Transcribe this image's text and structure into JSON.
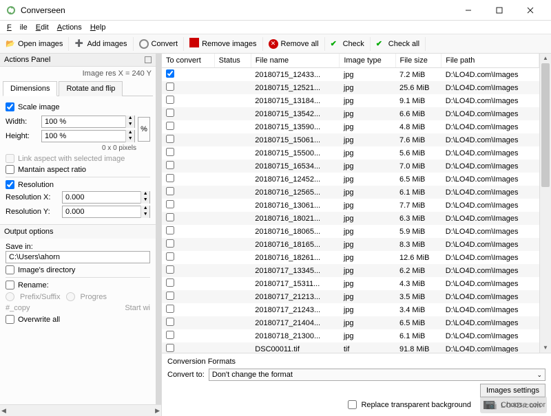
{
  "window": {
    "title": "Converseen"
  },
  "menu": {
    "file": "File",
    "edit": "Edit",
    "actions": "Actions",
    "help": "Help"
  },
  "toolbar": {
    "open": "Open images",
    "add": "Add images",
    "convert": "Convert",
    "remove": "Remove images",
    "removeall": "Remove all",
    "check": "Check",
    "checkall": "Check all"
  },
  "panel": {
    "title": "Actions Panel",
    "imgres": "Image res X = 240 Y",
    "tab_dimensions": "Dimensions",
    "tab_rotate": "Rotate and flip",
    "scale_image": "Scale image",
    "width_label": "Width:",
    "height_label": "Height:",
    "width_val": "100 %",
    "height_val": "100 %",
    "pct": "%",
    "pixels_note": "0 x 0 pixels",
    "link_aspect": "Link aspect with selected image",
    "maintain": "Mantain aspect ratio",
    "resolution": "Resolution",
    "resx_label": "Resolution X:",
    "resy_label": "Resolution Y:",
    "resx_val": "0.000",
    "resy_val": "0.000"
  },
  "output": {
    "title": "Output options",
    "savein_label": "Save in:",
    "savein_val": "C:\\Users\\ahorn",
    "images_dir": "Image's directory",
    "rename": "Rename:",
    "prefix": "Prefix/Suffix",
    "progressive": "Progres",
    "copy_placeholder": "#_copy",
    "startwith": "Start wi",
    "overwrite": "Overwrite all"
  },
  "table": {
    "headers": {
      "to_convert": "To convert",
      "status": "Status",
      "filename": "File name",
      "type": "Image type",
      "size": "File size",
      "path": "File path"
    },
    "rows": [
      {
        "checked": true,
        "name": "20180715_12433...",
        "type": "jpg",
        "size": "7.2 MiB",
        "path": "D:\\LO4D.com\\Images"
      },
      {
        "checked": false,
        "name": "20180715_12521...",
        "type": "jpg",
        "size": "25.6 MiB",
        "path": "D:\\LO4D.com\\Images"
      },
      {
        "checked": false,
        "name": "20180715_13184...",
        "type": "jpg",
        "size": "9.1 MiB",
        "path": "D:\\LO4D.com\\Images"
      },
      {
        "checked": false,
        "name": "20180715_13542...",
        "type": "jpg",
        "size": "6.6 MiB",
        "path": "D:\\LO4D.com\\Images"
      },
      {
        "checked": false,
        "name": "20180715_13590...",
        "type": "jpg",
        "size": "4.8 MiB",
        "path": "D:\\LO4D.com\\Images"
      },
      {
        "checked": false,
        "name": "20180715_15061...",
        "type": "jpg",
        "size": "7.6 MiB",
        "path": "D:\\LO4D.com\\Images"
      },
      {
        "checked": false,
        "name": "20180715_15500...",
        "type": "jpg",
        "size": "5.6 MiB",
        "path": "D:\\LO4D.com\\Images"
      },
      {
        "checked": false,
        "name": "20180715_16534...",
        "type": "jpg",
        "size": "7.0 MiB",
        "path": "D:\\LO4D.com\\Images"
      },
      {
        "checked": false,
        "name": "20180716_12452...",
        "type": "jpg",
        "size": "6.5 MiB",
        "path": "D:\\LO4D.com\\Images"
      },
      {
        "checked": false,
        "name": "20180716_12565...",
        "type": "jpg",
        "size": "6.1 MiB",
        "path": "D:\\LO4D.com\\Images"
      },
      {
        "checked": false,
        "name": "20180716_13061...",
        "type": "jpg",
        "size": "7.7 MiB",
        "path": "D:\\LO4D.com\\Images"
      },
      {
        "checked": false,
        "name": "20180716_18021...",
        "type": "jpg",
        "size": "6.3 MiB",
        "path": "D:\\LO4D.com\\Images"
      },
      {
        "checked": false,
        "name": "20180716_18065...",
        "type": "jpg",
        "size": "5.9 MiB",
        "path": "D:\\LO4D.com\\Images"
      },
      {
        "checked": false,
        "name": "20180716_18165...",
        "type": "jpg",
        "size": "8.3 MiB",
        "path": "D:\\LO4D.com\\Images"
      },
      {
        "checked": false,
        "name": "20180716_18261...",
        "type": "jpg",
        "size": "12.6 MiB",
        "path": "D:\\LO4D.com\\Images"
      },
      {
        "checked": false,
        "name": "20180717_13345...",
        "type": "jpg",
        "size": "6.2 MiB",
        "path": "D:\\LO4D.com\\Images"
      },
      {
        "checked": false,
        "name": "20180717_15311...",
        "type": "jpg",
        "size": "4.3 MiB",
        "path": "D:\\LO4D.com\\Images"
      },
      {
        "checked": false,
        "name": "20180717_21213...",
        "type": "jpg",
        "size": "3.5 MiB",
        "path": "D:\\LO4D.com\\Images"
      },
      {
        "checked": false,
        "name": "20180717_21243...",
        "type": "jpg",
        "size": "3.4 MiB",
        "path": "D:\\LO4D.com\\Images"
      },
      {
        "checked": false,
        "name": "20180717_21404...",
        "type": "jpg",
        "size": "6.5 MiB",
        "path": "D:\\LO4D.com\\Images"
      },
      {
        "checked": false,
        "name": "20180718_21300...",
        "type": "jpg",
        "size": "6.1 MiB",
        "path": "D:\\LO4D.com\\Images"
      },
      {
        "checked": false,
        "name": "DSC00011.tif",
        "type": "tif",
        "size": "91.8 MiB",
        "path": "D:\\LO4D.com\\Images"
      }
    ]
  },
  "conv": {
    "title": "Conversion Formats",
    "convert_to": "Convert to:",
    "format": "Don't change the format",
    "images_settings": "Images settings",
    "replace_bg": "Replace transparent background",
    "choose_color": "Choose color"
  },
  "watermark": "LO4D.com"
}
